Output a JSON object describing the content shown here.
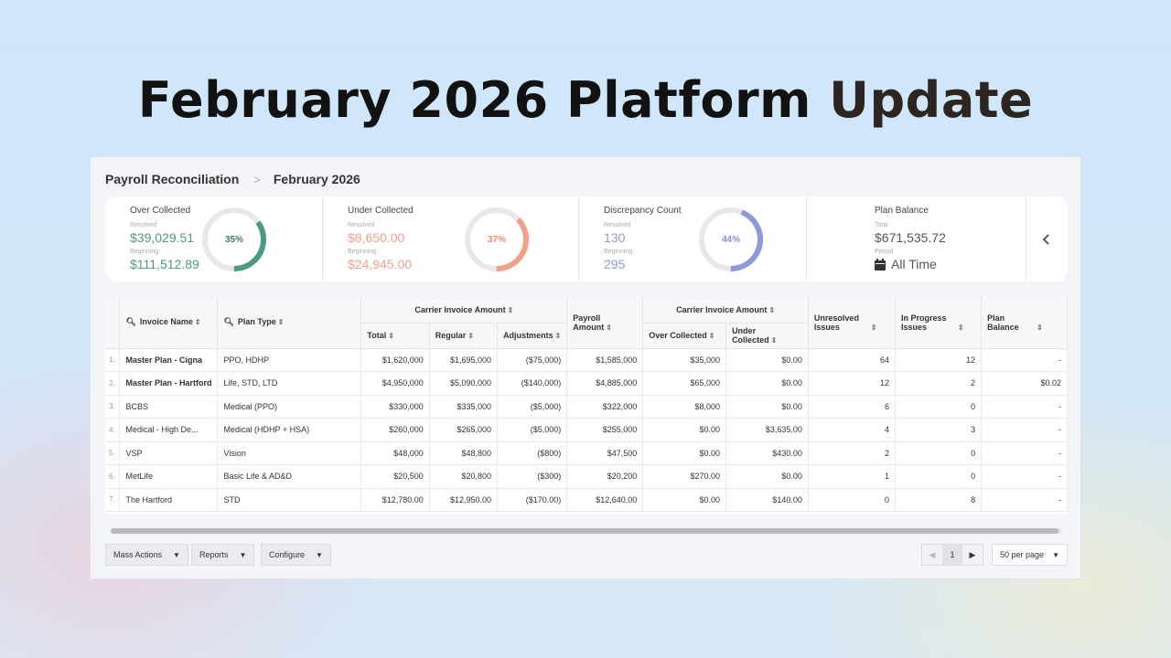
{
  "hero": {
    "title_main": "February 2026 Platform ",
    "title_accent": "Update"
  },
  "breadcrumb": {
    "root": "Payroll Reconciliation",
    "sep": ">",
    "current": "February 2026"
  },
  "kpis": [
    {
      "title": "Over Collected",
      "sub1": "Resolved",
      "val1": "$39,029.51",
      "sub2": "Beginning",
      "val2": "$111,512.89",
      "pct": "35%",
      "pct_value": 0.35,
      "color": "#4e9a7e"
    },
    {
      "title": "Under Collected",
      "sub1": "Resolved",
      "val1": "$8,650.00",
      "sub2": "Beginning",
      "val2": "$24,945.00",
      "pct": "37%",
      "pct_value": 0.37,
      "color": "#f3a089"
    },
    {
      "title": "Discrepancy Count",
      "sub1": "Resolved",
      "val1": "130",
      "sub2": "Beginning",
      "val2": "295",
      "pct": "44%",
      "pct_value": 0.44,
      "color": "#8c9ad9"
    },
    {
      "title": "Plan Balance",
      "sub1": "Total",
      "val1": "$671,535.72",
      "sub2": "Period",
      "val2": "All Time",
      "icon": "calendar-icon"
    }
  ],
  "kpi_nav_icon": "chevron-left-icon",
  "table": {
    "group_headers": {
      "carrier_invoice": "Carrier Invoice Amount",
      "carrier_invoice_2": "Carrier Invoice Amount"
    },
    "headers": {
      "invoice_name": "Invoice Name",
      "plan_type": "Plan Type",
      "total": "Total",
      "regular": "Regular",
      "adjustments": "Adjustments",
      "payroll_amount": "Payroll Amount",
      "over_collected": "Over Collected",
      "under_collected": "Under Collected",
      "unresolved": "Unresolved Issues",
      "in_progress": "In Progress Issues",
      "plan_balance": "Plan Balance"
    },
    "rows": [
      {
        "idx": "1.",
        "name": "Master Plan - Cigna",
        "bold": true,
        "plan": "PPO, HDHP",
        "total": "$1,620,000",
        "regular": "$1,695,000",
        "adj": "($75,000)",
        "payroll": "$1,585,000",
        "over": "$35,000",
        "under": "$0.00",
        "unresolved": "64",
        "progress": "12",
        "balance": "-"
      },
      {
        "idx": "2.",
        "name": "Master Plan - Hartford",
        "bold": true,
        "plan": "Life, STD, LTD",
        "total": "$4,950,000",
        "regular": "$5,090,000",
        "adj": "($140,000)",
        "payroll": "$4,885,000",
        "over": "$65,000",
        "under": "$0.00",
        "unresolved": "12",
        "progress": "2",
        "balance": "$0.02"
      },
      {
        "idx": "3.",
        "name": "BCBS",
        "bold": false,
        "plan": "Medical (PPO)",
        "total": "$330,000",
        "regular": "$335,000",
        "adj": "($5,000)",
        "payroll": "$322,000",
        "over": "$8,000",
        "under": "$0.00",
        "unresolved": "6",
        "progress": "0",
        "balance": "-"
      },
      {
        "idx": "4.",
        "name": "Medical - High De...",
        "bold": false,
        "plan": "Medical (HDHP + HSA)",
        "total": "$260,000",
        "regular": "$265,000",
        "adj": "($5,000)",
        "payroll": "$255,000",
        "over": "$0.00",
        "under": "$3,635.00",
        "unresolved": "4",
        "progress": "3",
        "balance": "-"
      },
      {
        "idx": "5.",
        "name": "VSP",
        "bold": false,
        "plan": "Vision",
        "total": "$48,000",
        "regular": "$48,800",
        "adj": "($800)",
        "payroll": "$47,500",
        "over": "$0.00",
        "under": "$430.00",
        "unresolved": "2",
        "progress": "0",
        "balance": "-"
      },
      {
        "idx": "6.",
        "name": "MetLife",
        "bold": false,
        "plan": "Basic Life & AD&D",
        "total": "$20,500",
        "regular": "$20,800",
        "adj": "($300)",
        "payroll": "$20,200",
        "over": "$270.00",
        "under": "$0.00",
        "unresolved": "1",
        "progress": "0",
        "balance": "-"
      },
      {
        "idx": "7.",
        "name": "The Hartford",
        "bold": false,
        "plan": "STD",
        "total": "$12,780.00",
        "regular": "$12,950.00",
        "adj": "($170.00)",
        "payroll": "$12,640.00",
        "over": "$0.00",
        "under": "$140.00",
        "unresolved": "0",
        "progress": "8",
        "balance": "-"
      }
    ]
  },
  "footer": {
    "mass_actions": "Mass Actions",
    "reports": "Reports",
    "configure": "Configure",
    "page": "1",
    "per_page": "50 per page"
  }
}
